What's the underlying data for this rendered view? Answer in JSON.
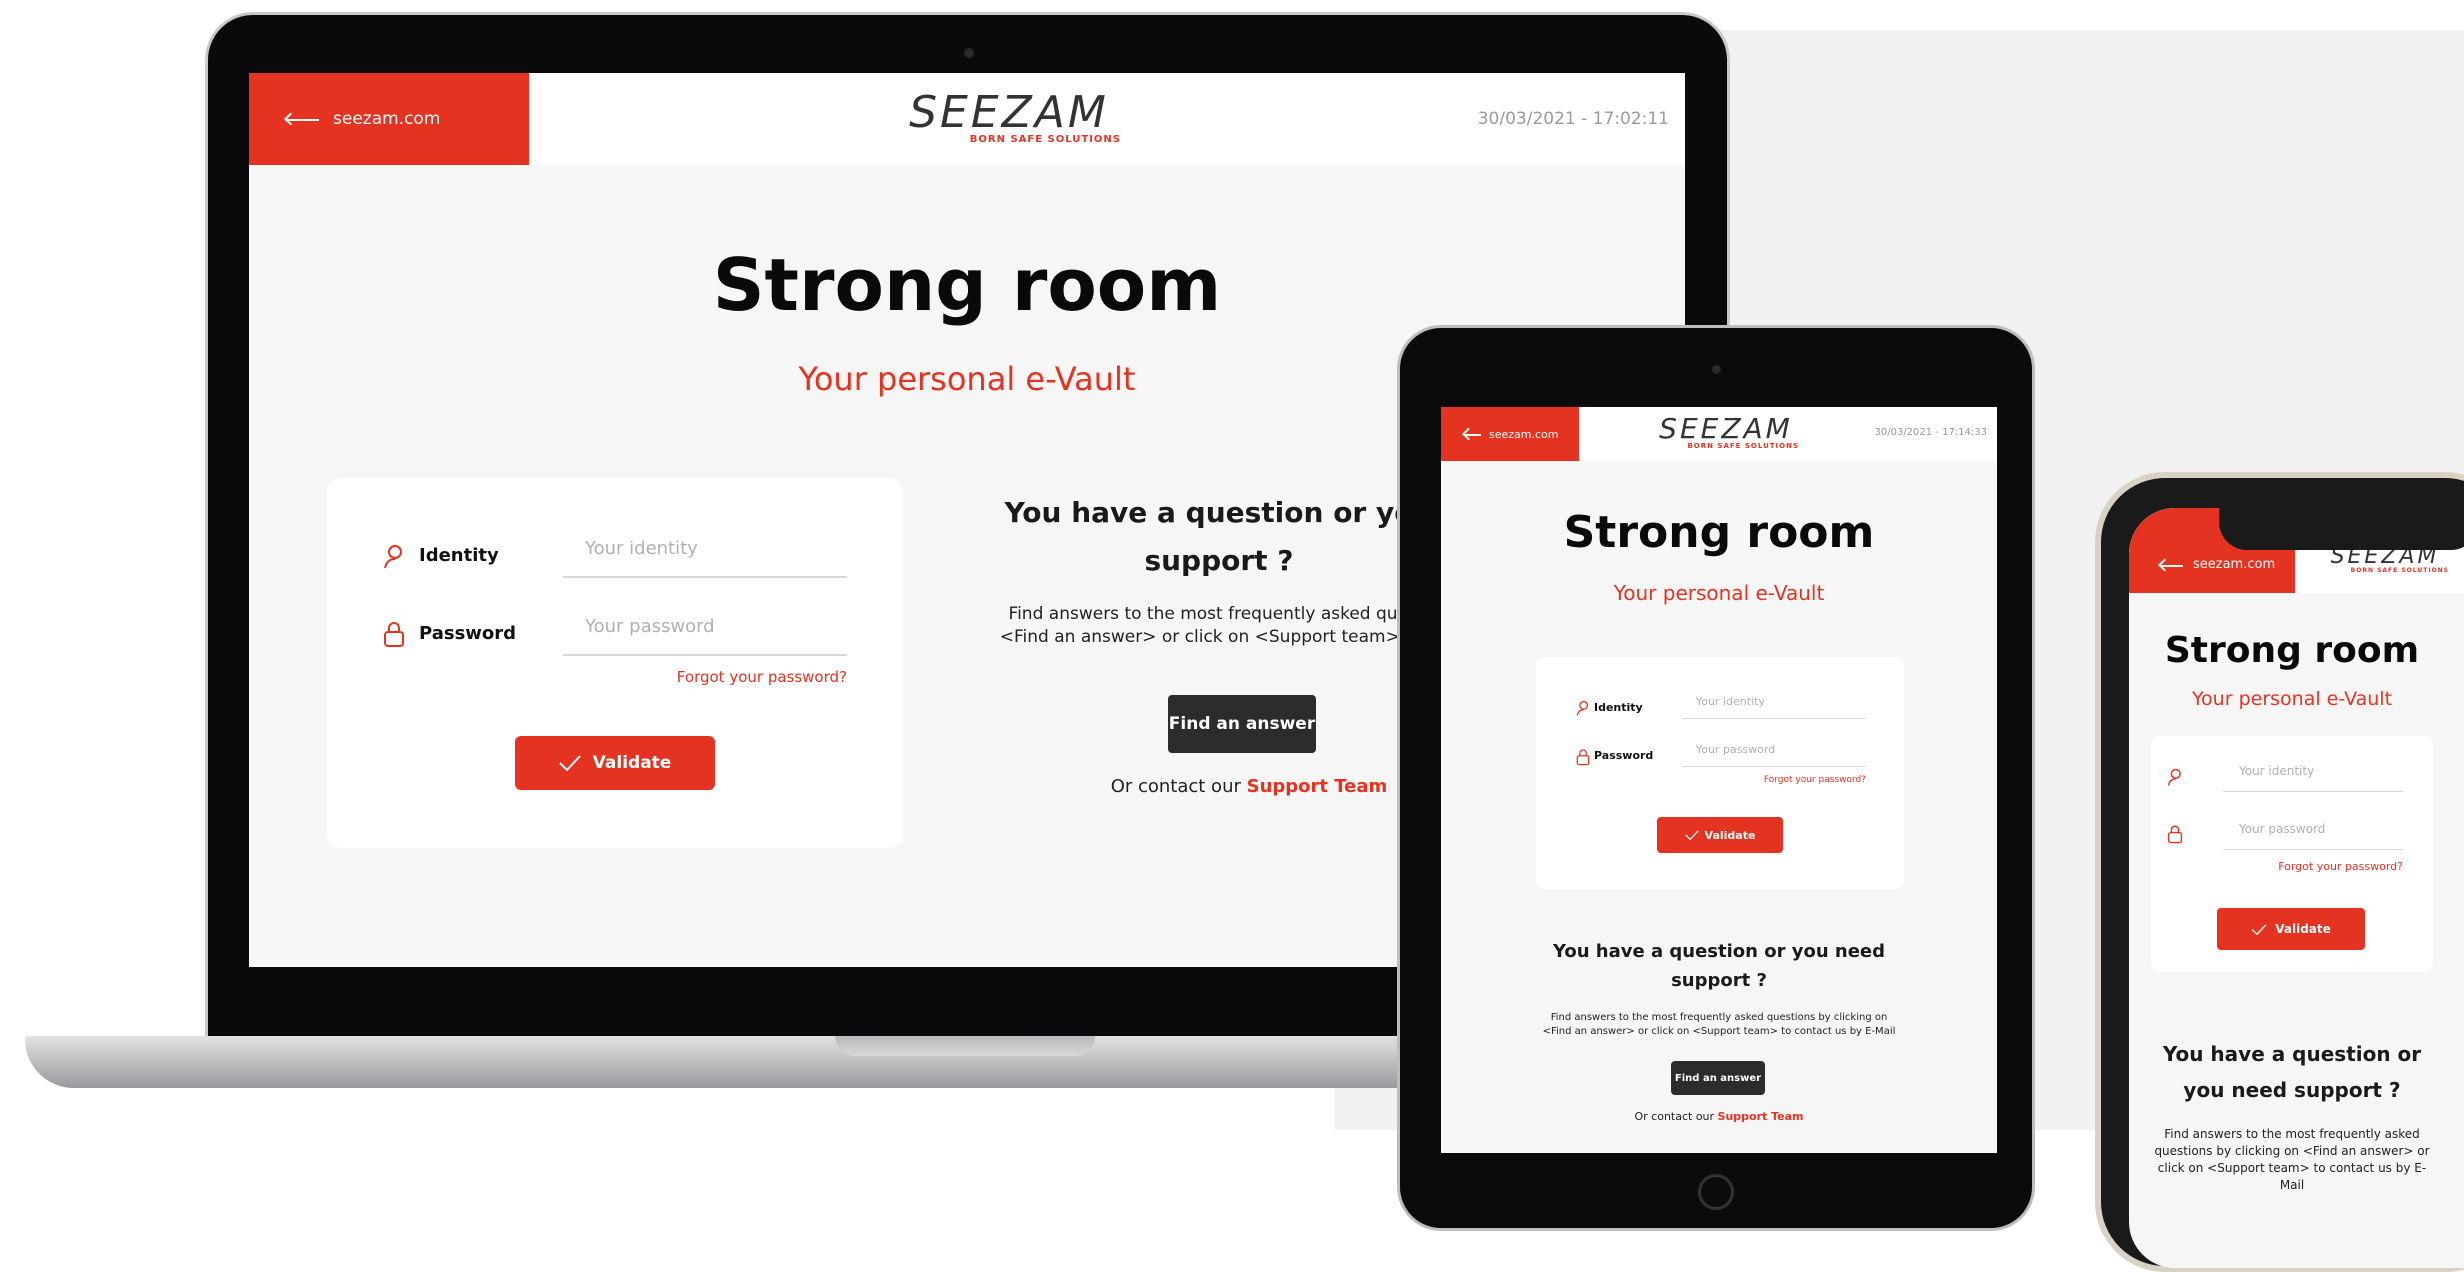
{
  "brand": {
    "logo_text": "SEEZAM",
    "logo_tagline": "BORN SAFE SOLUTIONS",
    "accent_color": "#e53322",
    "dark_button_color": "#2c2c2c"
  },
  "header": {
    "back_label": "seezam.com",
    "datetime_laptop": "30/03/2021 - 17:02:11",
    "datetime_tablet": "30/03/2021 - 17:14:33"
  },
  "page": {
    "title": "Strong room",
    "subtitle": "Your personal e-Vault"
  },
  "login": {
    "identity_label": "Identity",
    "identity_placeholder": "Your identity",
    "password_label": "Password",
    "password_placeholder": "Your password",
    "forgot_label": "Forgot your password?",
    "validate_label": "Validate"
  },
  "support": {
    "laptop_title_line1": "You have a question or you",
    "laptop_title_line2": "support ?",
    "laptop_text_line1": "Find answers to the most frequently asked question",
    "laptop_text_line2": "<Find an answer> or click on <Support team> to con",
    "title_line1": "You have a question or you need",
    "title_line2": "support ?",
    "text_line1": "Find answers to the most frequently asked questions by clicking on",
    "text_line2": "<Find an answer> or click on <Support team> to contact us by E-Mail",
    "phone_title_line1": "You have a question or",
    "phone_title_line2": "you need support ?",
    "phone_text_line1": "Find answers to the most frequently asked",
    "phone_text_line2": "questions by clicking on <Find an answer> or",
    "phone_text_line3": "click on <Support team> to contact us by E-",
    "phone_text_line4": "Mail",
    "find_answer_label": "Find an answer",
    "contact_prefix": "Or contact our",
    "contact_link": "Support Team"
  }
}
